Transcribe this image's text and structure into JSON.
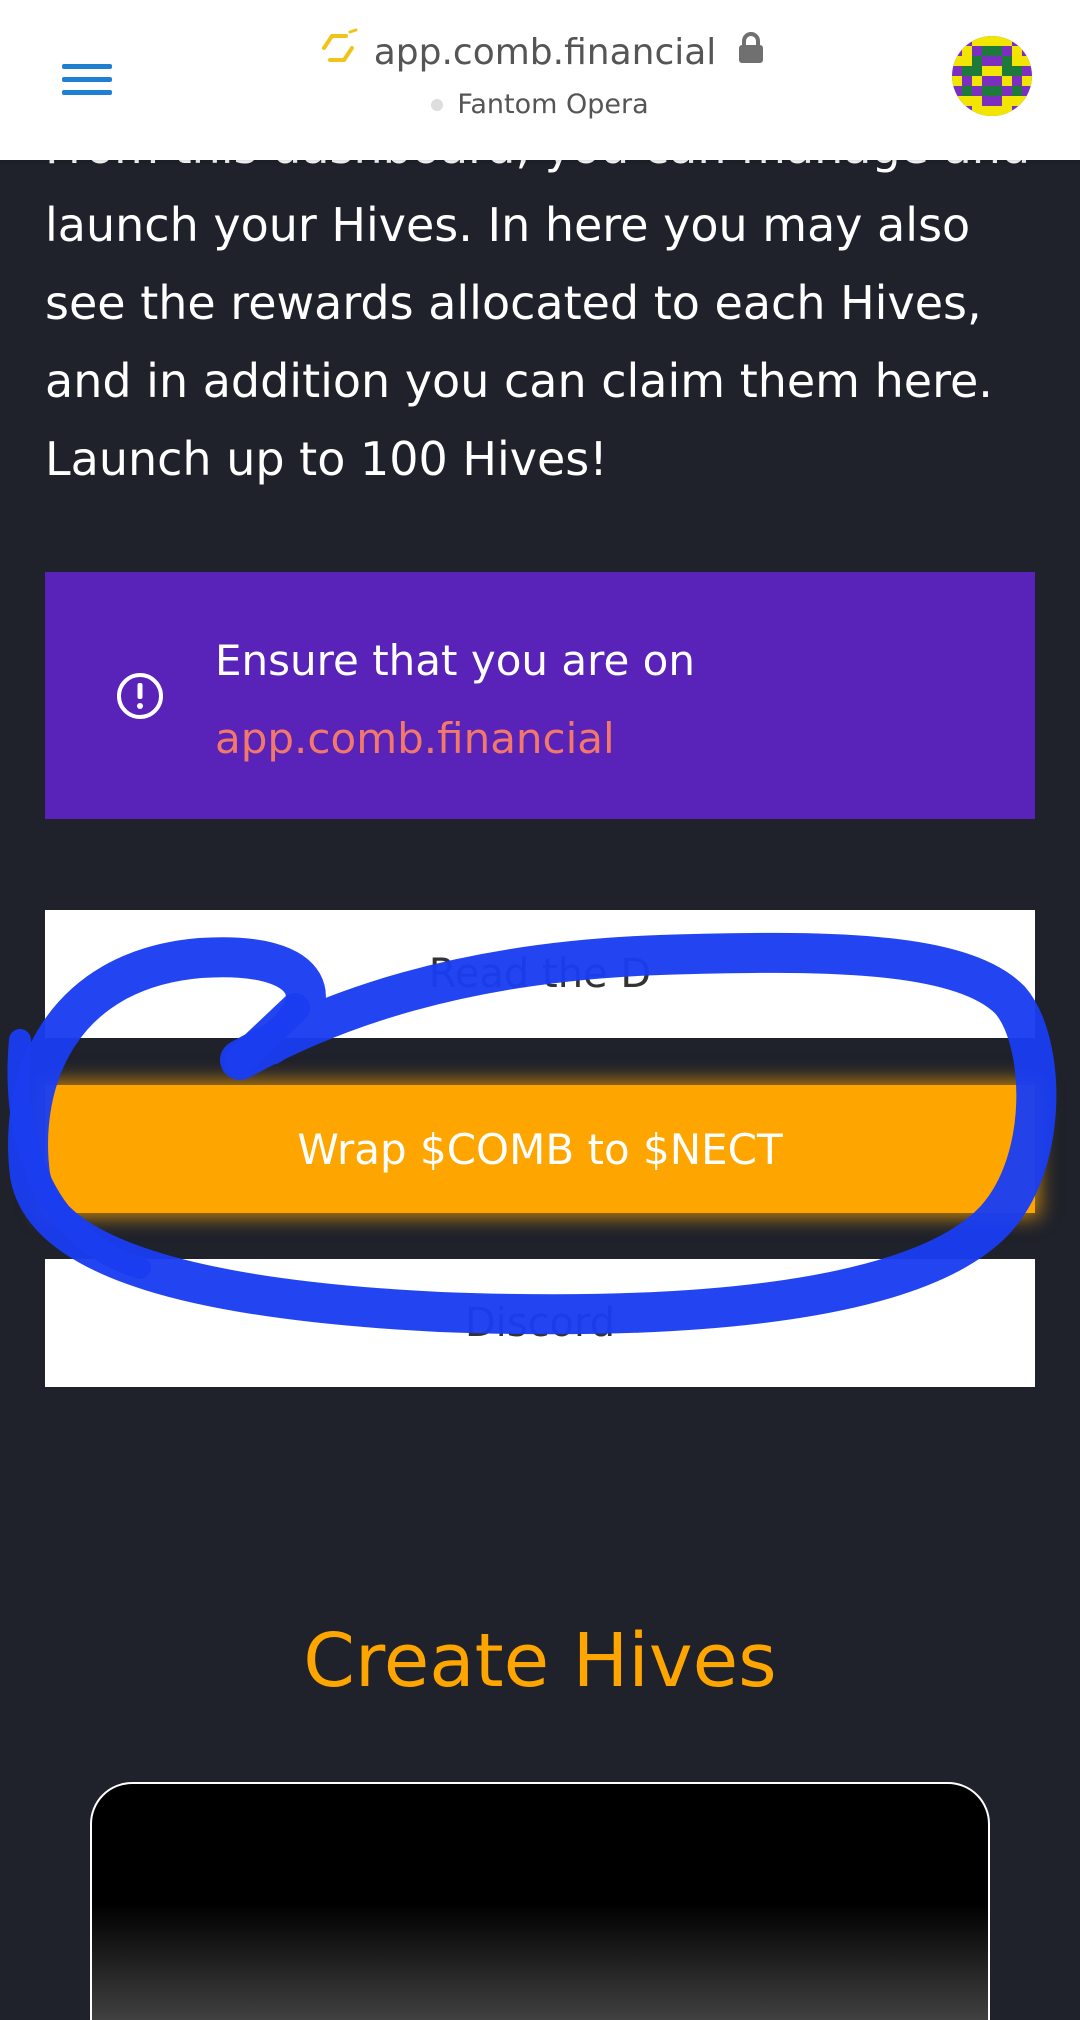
{
  "browser": {
    "url": "app.comb.financial",
    "network": "Fantom Opera",
    "site_icon": "link-hex-icon",
    "lock_icon": "lock-icon",
    "avatar": "identicon-avatar"
  },
  "intro": {
    "clipped_line": "From this dashboard, you can manage and",
    "lines": [
      "launch your Hives. In here you may also",
      "see the rewards allocated to each Hives,",
      "and in addition you can claim them here.",
      "Launch up to 100 Hives!"
    ]
  },
  "alert": {
    "text": "Ensure that you are on",
    "link": "app.comb.financial",
    "icon": "alert-circle-icon"
  },
  "buttons": {
    "top_partial": "Read the D",
    "wrap": "Wrap $COMB to $NECT",
    "bottom_partial": "Discord"
  },
  "section": {
    "title": "Create Hives"
  },
  "colors": {
    "background": "#1f222b",
    "accent_orange": "#ffa500",
    "alert_purple": "#5922b8",
    "link_salmon": "#f1786b",
    "menu_blue": "#1f7fd1",
    "annotation_blue": "#1a3df0"
  }
}
